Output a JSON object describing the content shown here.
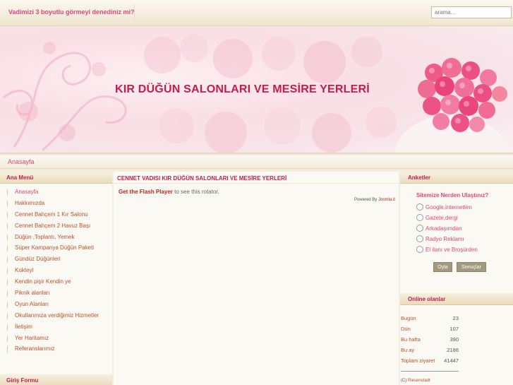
{
  "topbar": {
    "marquee_text": "Vadimizi 3 boyutlu görmeyi denediniz mi?",
    "search_placeholder": "arama..."
  },
  "header": {
    "title": "KIR DÜĞÜN SALONLARI VE MESİRE YERLERİ"
  },
  "breadcrumb": {
    "home": "Anasayfa"
  },
  "left": {
    "main_menu_title": "Ana Menü",
    "menu_items": [
      "Anasayfa",
      "Hakkımızda",
      "Cennet Bahçem 1 Kır Salonu",
      "Cennet Bahçem 2 Havuz Başı",
      "Düğün ,Toplantı, Yemek",
      "Süper Kampanya Düğün Paketi",
      "Gündüz Düğünleri",
      "Kokteyl",
      "Kendin pişir Kendin ye",
      "Piknik alanları",
      "Oyun Alanları",
      "Okullarımıza verdiğimiz Hizmetler",
      "İletişim",
      "Yer Haritamız",
      "Referanslarımız"
    ],
    "login_title": "Giriş Formu"
  },
  "center": {
    "header": "CENNET VADISI KIR DÜĞÜN SALONLARI VE MESİRE YERLERİ",
    "flash_link": "Get the Flash Player",
    "flash_text": " to see this rotator.",
    "powered_by": "Powered By ",
    "powered_link": "Joomla.it"
  },
  "right": {
    "poll_title": "Anketler",
    "poll_question": "Sitemize Nerden Ulaştınız?",
    "poll_options": [
      "Google,internetten",
      "Gazete,dergi",
      "Arkadaşımdan",
      "Radyo Reklamı",
      "El ilanı ve Broşürden"
    ],
    "vote_button": "Oyla",
    "results_button": "Sonuçlar",
    "online_title": "Online olanlar",
    "stats": [
      {
        "label": "Bugün",
        "value": "23"
      },
      {
        "label": "Dün",
        "value": "107"
      },
      {
        "label": "Bu hafta",
        "value": "390"
      },
      {
        "label": "Bu ay",
        "value": "2186"
      },
      {
        "label": "Toplam ziyaret",
        "value": "41447"
      }
    ],
    "credit_prefix": "(C) ",
    "credit_name": "Riesenstadt"
  },
  "colors": {
    "accent": "#e0457b",
    "title": "#c31c4f",
    "link_brown": "#b5522b"
  }
}
